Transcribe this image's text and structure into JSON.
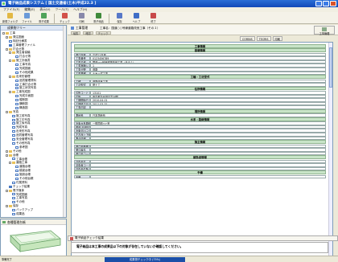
{
  "window": {
    "title": "電子納品成果システム [ 国土交通省(土木)平成22.3 ]"
  },
  "menu": [
    "ファイル(F)",
    "編集(E)",
    "表示(V)",
    "ツール(T)",
    "ヘルプ(H)"
  ],
  "toolbar": [
    {
      "label": "新規フォルダ",
      "color": "#e2b844"
    },
    {
      "label": "ファイル",
      "color": "#6a9ad8"
    },
    {
      "label": "電子成果",
      "color": "#4fa35a"
    },
    {
      "label": "チェック",
      "color": "#d2524a"
    },
    {
      "label": "印刷",
      "color": "#8888aa"
    },
    {
      "label": "電子納品",
      "color": "#3f8a3a"
    },
    {
      "label": "保存",
      "color": "#5778c8"
    },
    {
      "label": "ヘルプ",
      "color": "#3f6ec6"
    },
    {
      "label": "終了",
      "color": "#c84a4a"
    }
  ],
  "tree": {
    "header": "成果物ツリー",
    "items": [
      {
        "label": "工事",
        "indent": 0,
        "icon": "folder"
      },
      {
        "label": "発注図面",
        "indent": 1,
        "icon": "folder"
      },
      {
        "label": "特記仕様書",
        "indent": 1,
        "icon": "doc"
      },
      {
        "label": "工事管理ファイル",
        "indent": 1,
        "icon": "blue"
      },
      {
        "label": "打合せ簿",
        "indent": 1,
        "icon": "folder"
      },
      {
        "label": "発注者協議",
        "indent": 2,
        "icon": "folder"
      },
      {
        "label": "打合せ簿",
        "indent": 3,
        "icon": "doc"
      },
      {
        "label": "施工計画書",
        "indent": 2,
        "icon": "folder"
      },
      {
        "label": "工事写真",
        "indent": 3,
        "icon": "doc"
      },
      {
        "label": "完成図面",
        "indent": 3,
        "icon": "doc"
      },
      {
        "label": "その他成果",
        "indent": 3,
        "icon": "doc"
      },
      {
        "label": "出来形管理",
        "indent": 2,
        "icon": "folder"
      },
      {
        "label": "品質管理資料",
        "indent": 3,
        "icon": "doc"
      },
      {
        "label": "工事打合せ簿",
        "indent": 3,
        "icon": "doc"
      },
      {
        "label": "施工状況写真",
        "indent": 3,
        "icon": "doc"
      },
      {
        "label": "工事完成図",
        "indent": 2,
        "icon": "folder"
      },
      {
        "label": "完成平面図",
        "indent": 3,
        "icon": "doc"
      },
      {
        "label": "縦断図",
        "indent": 3,
        "icon": "doc"
      },
      {
        "label": "横断図",
        "indent": 3,
        "icon": "doc"
      },
      {
        "label": "構造図",
        "indent": 3,
        "icon": "doc"
      },
      {
        "label": "写真",
        "indent": 1,
        "icon": "folder"
      },
      {
        "label": "施工前写真",
        "indent": 2,
        "icon": "doc"
      },
      {
        "label": "施工中写真",
        "indent": 2,
        "icon": "doc"
      },
      {
        "label": "施工後写真",
        "indent": 2,
        "icon": "doc"
      },
      {
        "label": "完成写真",
        "indent": 2,
        "icon": "doc"
      },
      {
        "label": "出来形写真",
        "indent": 2,
        "icon": "doc"
      },
      {
        "label": "品質管理写真",
        "indent": 2,
        "icon": "doc"
      },
      {
        "label": "安全管理写真",
        "indent": 2,
        "icon": "doc"
      },
      {
        "label": "その他写真",
        "indent": 2,
        "icon": "doc"
      },
      {
        "label": "参考図",
        "indent": 3,
        "icon": "doc"
      },
      {
        "label": "その他",
        "indent": 1,
        "icon": "folder"
      },
      {
        "label": "台帳",
        "indent": 1,
        "icon": "folder"
      },
      {
        "label": "工事台帳",
        "indent": 2,
        "icon": "doc"
      },
      {
        "label": "道路工事",
        "indent": 2,
        "icon": "folder"
      },
      {
        "label": "道路台帳",
        "indent": 3,
        "icon": "doc"
      },
      {
        "label": "橋梁台帳",
        "indent": 3,
        "icon": "doc"
      },
      {
        "label": "施設台帳",
        "indent": 3,
        "icon": "doc"
      },
      {
        "label": "その他台帳",
        "indent": 3,
        "icon": "doc"
      },
      {
        "label": "付属資料",
        "indent": 2,
        "icon": "doc"
      },
      {
        "label": "チェック結果",
        "indent": 1,
        "icon": "blue"
      },
      {
        "label": "電子媒体",
        "indent": 1,
        "icon": "folder"
      },
      {
        "label": "完成図面",
        "indent": 2,
        "icon": "doc"
      },
      {
        "label": "工事写真",
        "indent": 2,
        "icon": "doc"
      },
      {
        "label": "その他",
        "indent": 2,
        "icon": "doc"
      },
      {
        "label": "保存",
        "indent": 1,
        "icon": "folder"
      },
      {
        "label": "バックアップ",
        "indent": 2,
        "icon": "doc"
      },
      {
        "label": "成果品",
        "indent": 2,
        "icon": "doc"
      }
    ]
  },
  "shape_panel": {
    "title": "各種管理台帳",
    "caption": "電子納品 Ver.1.0 納品成果物"
  },
  "doc": {
    "title": "工事管理",
    "path": "工事名：国道○○号線道路改良工事（その１）",
    "sub_tabs": [
      "編集",
      "確認",
      "チェック"
    ],
    "side_button": "工事管理"
  },
  "panel_tabs": [
    "CORINS",
    "TECRIS",
    "印刷"
  ],
  "form": {
    "rows": [
      {
        "type": "sec",
        "text": "工事情報"
      },
      {
        "type": "sec",
        "text": "基礎情報"
      },
      {
        "type": "field",
        "label": "発注年度",
        "value": "平成22年度"
      },
      {
        "type": "field",
        "label": "工事番号",
        "value": "0123456789"
      },
      {
        "type": "field",
        "label": "工事名称",
        "value": "国道○○号線道路改良工事（その１）"
      },
      {
        "type": "field",
        "label": "工事実績システム",
        "value": "1"
      },
      {
        "type": "field",
        "label": "工事分野",
        "value": "道路"
      },
      {
        "type": "field",
        "label": "工事業種",
        "value": "土木一式工事"
      },
      {
        "type": "sec",
        "text": "工種・工法型式"
      },
      {
        "type": "field",
        "label": "工種",
        "value": "道路改良工事"
      },
      {
        "type": "field",
        "label": "工法型式",
        "value": "盛土工"
      },
      {
        "type": "sec",
        "text": "住所情報"
      },
      {
        "type": "field",
        "label": "住所コード",
        "value": "13101"
      },
      {
        "type": "field",
        "label": "住所",
        "value": "東京都千代田区霞が関"
      },
      {
        "type": "field",
        "label": "工期開始日",
        "value": "2010-04-01"
      },
      {
        "type": "field",
        "label": "工期終了日",
        "value": "2011-03-31"
      },
      {
        "type": "field",
        "label": "工事内容",
        "value": ""
      },
      {
        "type": "sec",
        "text": "場所情報"
      },
      {
        "type": "field",
        "label": "測地系",
        "value": "日本測地系"
      },
      {
        "type": "sec",
        "text": "水系・路線情報"
      },
      {
        "type": "field",
        "label": "対象水系路線名",
        "value": "一般国道○○号"
      },
      {
        "type": "field",
        "label": "現道-旧道区分",
        "value": ""
      },
      {
        "type": "field",
        "label": "対象河川コード",
        "value": ""
      },
      {
        "type": "field",
        "label": "左右岸上下線",
        "value": ""
      },
      {
        "type": "field",
        "label": "測点情報",
        "value": ""
      },
      {
        "type": "sec",
        "text": "施主情報"
      },
      {
        "type": "field",
        "label": "発注者機関",
        "value": ""
      },
      {
        "type": "field",
        "label": "発注者名",
        "value": ""
      },
      {
        "type": "field",
        "label": "発注者コード",
        "value": ""
      },
      {
        "type": "sec",
        "text": "請負者情報"
      },
      {
        "type": "field",
        "label": "請負者名",
        "value": ""
      },
      {
        "type": "field",
        "label": "請負者コード",
        "value": ""
      },
      {
        "type": "field",
        "label": "請負者住所",
        "value": ""
      },
      {
        "type": "sec",
        "text": "予備"
      },
      {
        "type": "field",
        "label": "予備",
        "value": ""
      }
    ]
  },
  "check_bar": "電子納品チェック結果",
  "check_message": "電子納品は本工事の成果品以下の対象が存在していないか確認してください。",
  "status": {
    "left": "準備完了",
    "progress_text": "成果物チェック中 (75%)",
    "progress": 0.75
  },
  "colors": {
    "titlebar": "#1148b8",
    "section": "#c8e4c8",
    "label": "#e8edf8"
  }
}
